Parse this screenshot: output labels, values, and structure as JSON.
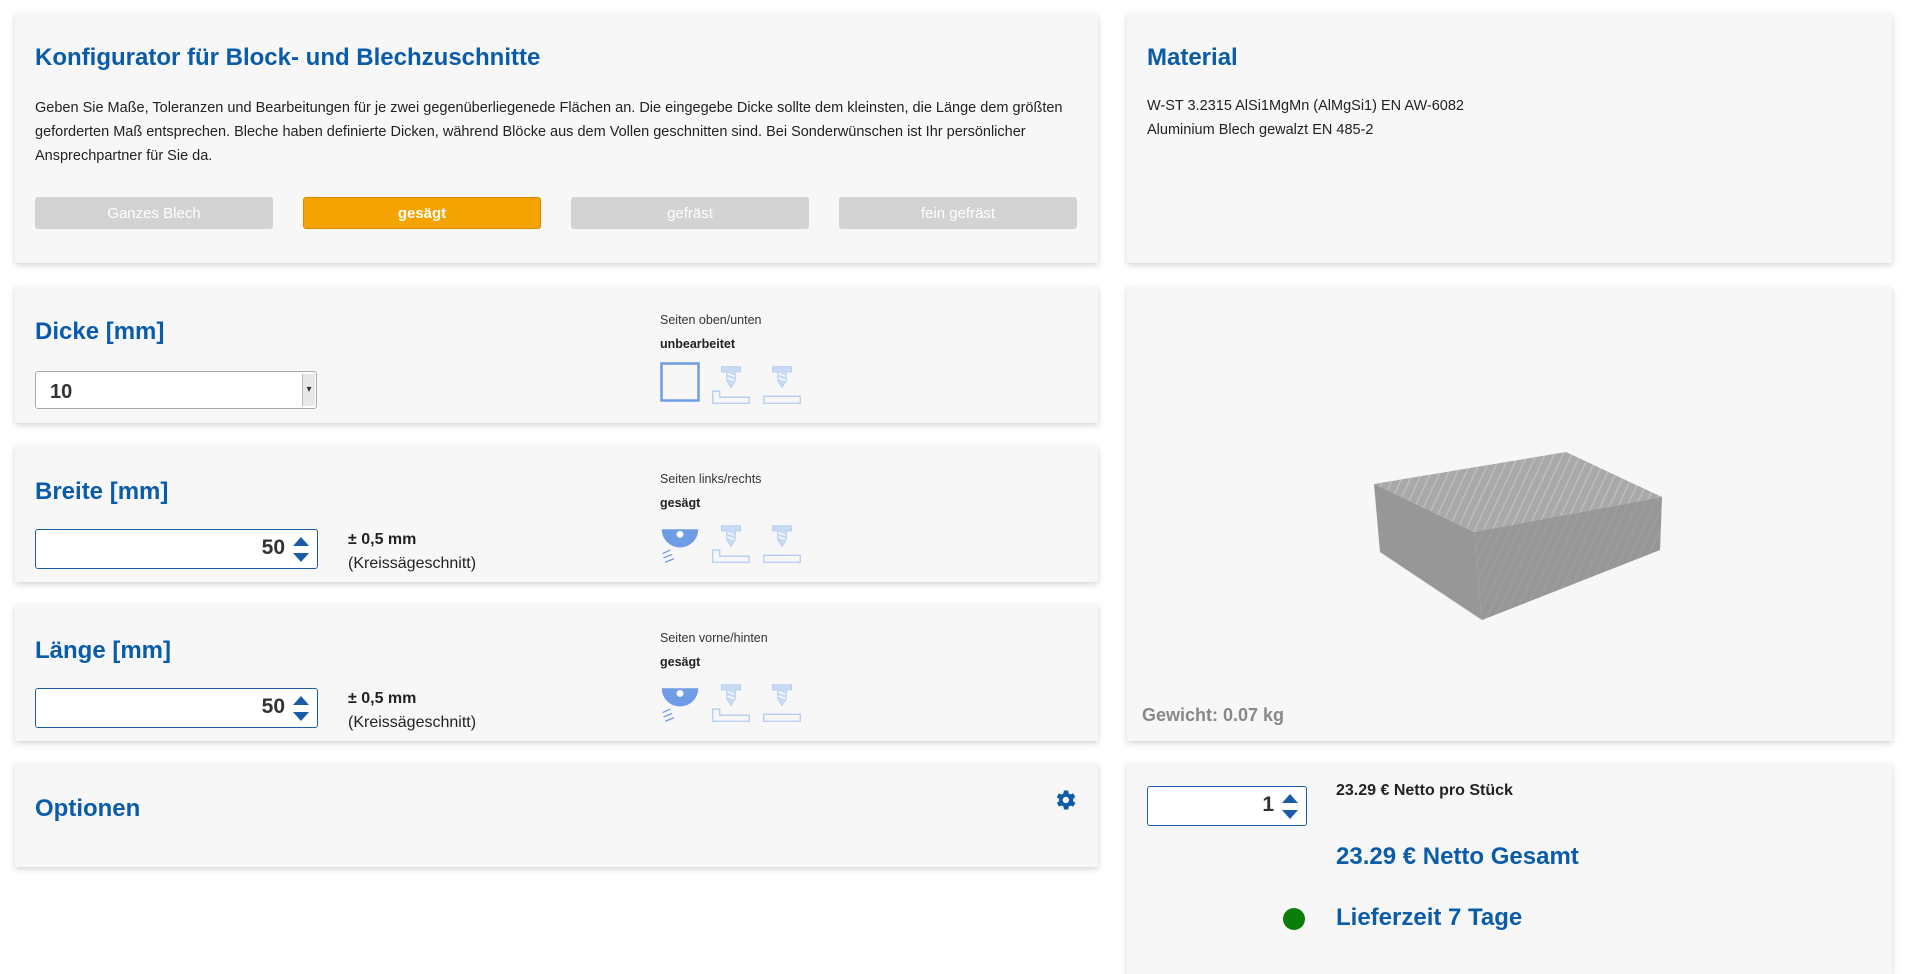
{
  "configurator": {
    "title": "Konfigurator für Block- und Blechzuschnitte",
    "description_lines": [
      "Geben Sie Maße, Toleranzen und Bearbeitungen für je zwei gegenüberliegenede Flächen an. Die eingegebe Dicke sollte dem kleinsten, die Länge dem größten",
      "geforderten Maß entsprechen. Bleche haben definierte Dicken, während Blöcke aus dem Vollen geschnitten sind. Bei Sonderwünschen ist Ihr persönlicher",
      "Ansprechpartner für Sie da."
    ],
    "modes": [
      {
        "label": "Ganzes Blech",
        "active": false
      },
      {
        "label": "gesägt",
        "active": true
      },
      {
        "label": "gefräst",
        "active": false
      },
      {
        "label": "fein gefräst",
        "active": false
      }
    ]
  },
  "material": {
    "title": "Material",
    "line1": "W-ST 3.2315 AlSi1MgMn (AlMgSi1) EN AW-6082",
    "line2": "Aluminium Blech gewalzt EN 485-2"
  },
  "dicke": {
    "title": "Dicke [mm]",
    "value": "10",
    "sides_label": "Seiten oben/unten",
    "sides_value": "unbearbeitet"
  },
  "breite": {
    "title": "Breite [mm]",
    "value": "50",
    "tolerance": "± 0,5 mm",
    "tolerance_note": "(Kreissägeschnitt)",
    "sides_label": "Seiten links/rechts",
    "sides_value": "gesägt"
  },
  "laenge": {
    "title": "Länge [mm]",
    "value": "50",
    "tolerance": "± 0,5 mm",
    "tolerance_note": "(Kreissägeschnitt)",
    "sides_label": "Seiten vorne/hinten",
    "sides_value": "gesägt"
  },
  "optionen": {
    "title": "Optionen"
  },
  "preview": {
    "weight": "Gewicht: 0.07 kg"
  },
  "order": {
    "quantity": "1",
    "unit_price": "23.29 € Netto pro Stück",
    "total_price": "23.29 € Netto Gesamt",
    "delivery": "Lieferzeit 7 Tage",
    "delivery_status_color": "#0a7d0a"
  },
  "colors": {
    "accent_blue": "#0a5ca8",
    "active_orange": "#f5a300",
    "inactive_grey": "#d3d3d3",
    "icon_light_blue": "#b5cdf2"
  }
}
